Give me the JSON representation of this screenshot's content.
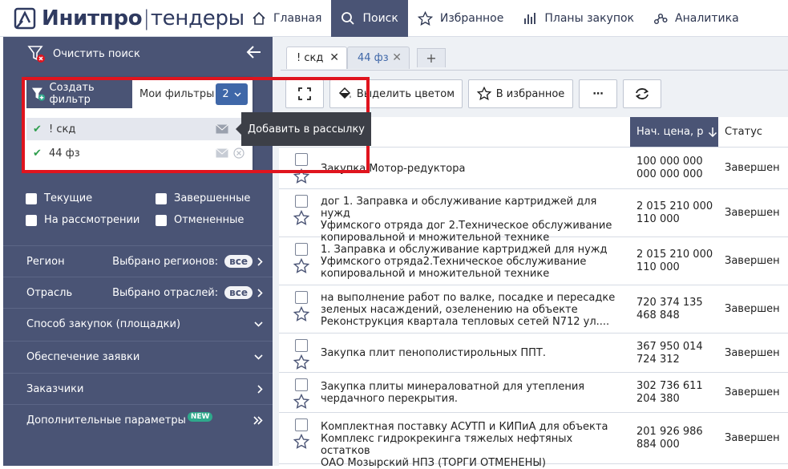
{
  "app": {
    "logo_bold": "Инитпро",
    "logo_sep": "|",
    "logo_rest": "тендеры"
  },
  "nav": [
    {
      "label": "Главная",
      "icon": "home-icon"
    },
    {
      "label": "Поиск",
      "icon": "search-icon"
    },
    {
      "label": "Избранное",
      "icon": "star-icon"
    },
    {
      "label": "Планы закупок",
      "icon": "bar-chart-icon"
    },
    {
      "label": "Аналитика",
      "icon": "analytics-icon"
    }
  ],
  "sidebar": {
    "clear_search": "Очистить поиск",
    "create_filter": "Создать фильтр",
    "my_filters": "Мои фильтры",
    "filters_count": "2",
    "filters": [
      {
        "name": "! скд"
      },
      {
        "name": "44 фз"
      }
    ],
    "tooltip": "Добавить в рассылку",
    "checkboxes": [
      "Текущие",
      "Завершенные",
      "На рассмотрении",
      "Отмененные"
    ],
    "rows": [
      {
        "label": "Регион",
        "selected_text": "Выбрано регионов:",
        "pill": "все"
      },
      {
        "label": "Отрасль",
        "selected_text": "Выбрано отраслей:",
        "pill": "все"
      },
      {
        "label": "Способ закупок (площадки)"
      },
      {
        "label": "Обеспечение заявки"
      },
      {
        "label": "Заказчики"
      },
      {
        "label": "Дополнительные параметры",
        "badge": "NEW"
      }
    ]
  },
  "tabs": [
    {
      "label": "! скд",
      "close": "✕"
    },
    {
      "label": "44 фз",
      "close": "✕"
    }
  ],
  "tab_add": "+",
  "toolbar": {
    "highlight": "Выделить цветом",
    "favorite": "В избранное",
    "more": "⋯"
  },
  "table": {
    "col_price": "Нач. цена, р",
    "col_status": "Статус",
    "rows": [
      {
        "name": [
          "Закупка Мотор-редуктора"
        ],
        "price": [
          "100 000 000",
          "000 000 000"
        ],
        "status": "Завершен"
      },
      {
        "name": [
          "дог 1. Заправка и обслуживание картриджей для нужд",
          "Уфимского отряда дог 2.Техническое обслуживание",
          "копировальной и множительной технике"
        ],
        "price": [
          "2 015 210 000",
          "110 000"
        ],
        "status": "Завершен"
      },
      {
        "name": [
          "1. Заправка и обслуживание картриджей для нужд",
          "Уфимского отряда2.Техническое обслуживание",
          "копировальной и множительной технике"
        ],
        "price": [
          "2 015 210 000",
          "110 000"
        ],
        "status": "Завершен"
      },
      {
        "name": [
          "на выполнение работ по валке, посадке и пересадке",
          "зеленых насаждений, озеленению на объекте",
          "Реконструкция квартала тепловых сетей N712 ул...."
        ],
        "price": [
          "720 374 135",
          "468 848"
        ],
        "status": "Завершен"
      },
      {
        "name": [
          "Закупка плит пенополистирольных ППТ."
        ],
        "price": [
          "367 950 014",
          "724 312"
        ],
        "status": "Завершен"
      },
      {
        "name": [
          "Закупка плиты минераловатной для утепления",
          "чердачного перекрытия."
        ],
        "price": [
          "302 736 611",
          "204 380"
        ],
        "status": "Завершен"
      },
      {
        "name": [
          "Комплектная поставку АСУТП и КИПиА для объекта",
          "Комплекс гидрокрекинга тяжелых нефтяных остатков",
          "ОАО Мозырский НПЗ (ТОРГИ ОТМЕНЕНЫ)"
        ],
        "price": [
          "201 926 986",
          "884 000"
        ],
        "status": "Завершен"
      }
    ]
  }
}
